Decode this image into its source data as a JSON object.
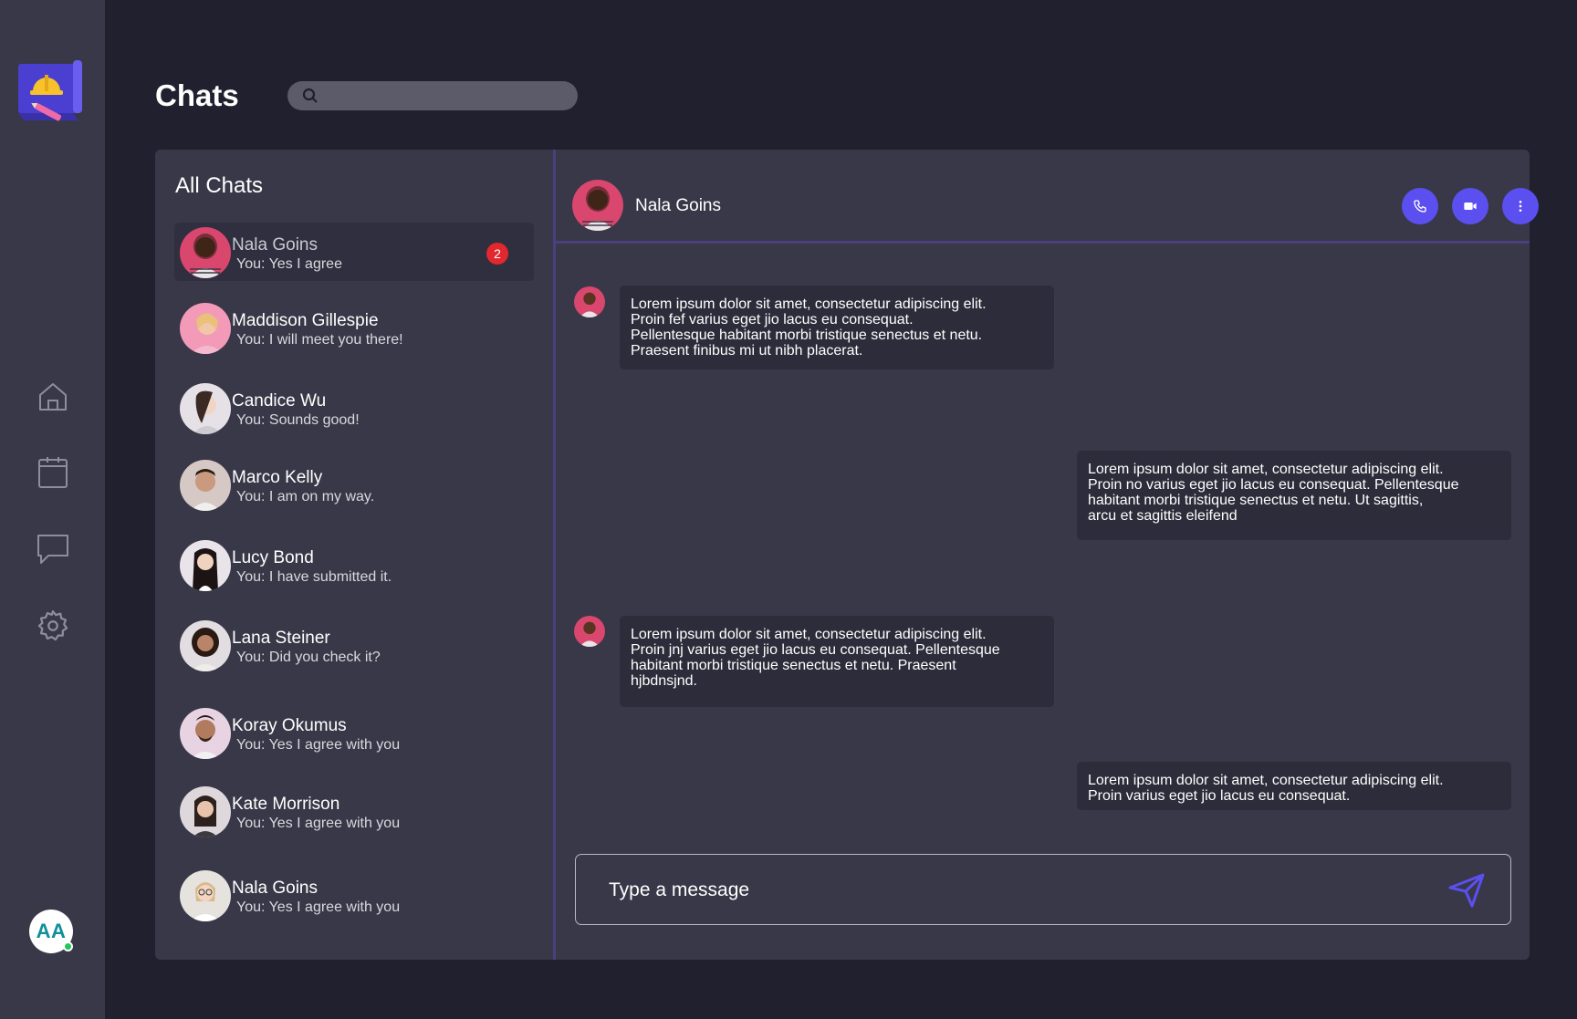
{
  "page": {
    "title": "Chats"
  },
  "search": {
    "placeholder": ""
  },
  "sidebar": {
    "nav": [
      {
        "name": "home",
        "icon": "home-icon"
      },
      {
        "name": "calendar",
        "icon": "calendar-icon"
      },
      {
        "name": "chat",
        "icon": "chat-icon"
      },
      {
        "name": "settings",
        "icon": "gear-icon"
      }
    ],
    "user_initials": "AA"
  },
  "chat_list": {
    "heading": "All Chats",
    "items": [
      {
        "name": "Nala Goins",
        "preview": "You: Yes I agree",
        "unread": "2",
        "active": true,
        "avatar_color": "#d9476e"
      },
      {
        "name": "Maddison Gillespie",
        "preview": "You: I will meet you there!",
        "avatar_color": "#f29ab8"
      },
      {
        "name": "Candice Wu",
        "preview": "You: Sounds good!",
        "avatar_color": "#e5e1e6"
      },
      {
        "name": "Marco Kelly",
        "preview": "You: I am on my way.",
        "avatar_color": "#d6c8c4"
      },
      {
        "name": "Lucy Bond",
        "preview": "You: I have submitted it.",
        "avatar_color": "#e9e3ea"
      },
      {
        "name": "Lana Steiner",
        "preview": "You: Did you check it?",
        "avatar_color": "#e2dde0"
      },
      {
        "name": "Koray Okumus",
        "preview": "You: Yes I agree with you",
        "avatar_color": "#e7d3e2"
      },
      {
        "name": "Kate Morrison",
        "preview": "You: Yes I agree with you",
        "avatar_color": "#ded8dc"
      },
      {
        "name": "Nala Goins",
        "preview": "You: Yes I agree with you",
        "avatar_color": "#e6e2de"
      }
    ]
  },
  "conversation": {
    "contact_name": "Nala Goins",
    "messages": [
      {
        "from": "contact",
        "text": "Lorem ipsum dolor sit amet, consectetur adipiscing elit.\nProin fef varius eget jio lacus eu consequat.\nPellentesque habitant morbi tristique senectus et netu.\nPraesent finibus mi ut nibh placerat."
      },
      {
        "from": "me",
        "text": "Lorem ipsum dolor sit amet, consectetur adipiscing elit.\nProin no varius eget jio lacus eu consequat. Pellentesque\nhabitant morbi tristique senectus et netu. Ut sagittis,\narcu et sagittis eleifend"
      },
      {
        "from": "contact",
        "text": "Lorem ipsum dolor sit amet, consectetur adipiscing elit.\nProin jnj varius eget jio lacus eu consequat. Pellentesque\nhabitant morbi tristique senectus et netu. Praesent\nhjbdnsjnd."
      },
      {
        "from": "me",
        "text": "Lorem ipsum dolor sit amet, consectetur adipiscing elit.\nProin varius eget jio lacus eu consequat."
      }
    ],
    "composer_placeholder": "Type a message"
  },
  "colors": {
    "accent": "#5b4ff0",
    "badge": "#e0282e",
    "background": "#21202f",
    "panel": "#393848",
    "bubble": "#2d2c3a",
    "divider": "#4c3f7e",
    "online": "#22c55e"
  }
}
